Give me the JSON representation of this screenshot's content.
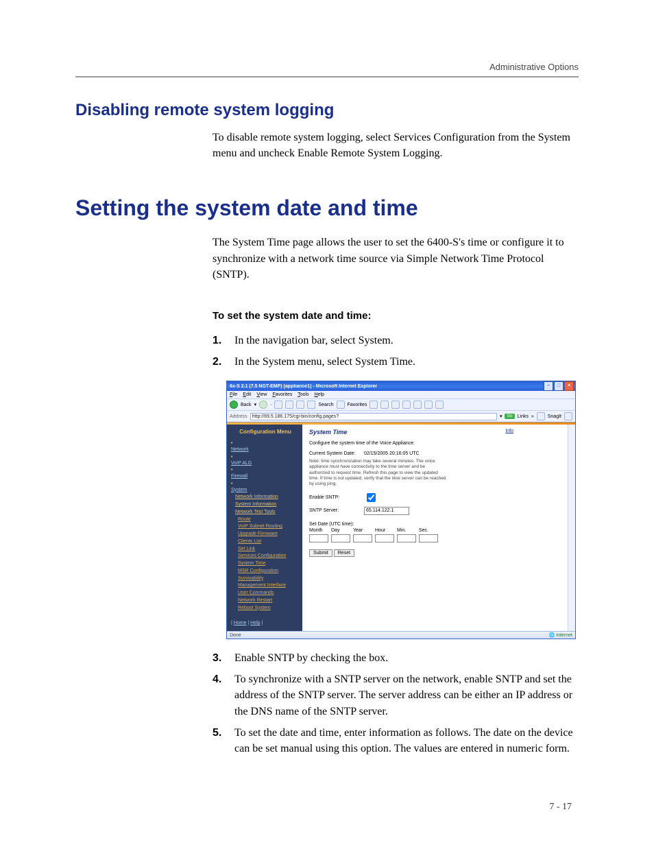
{
  "header": {
    "chapter": "Administrative Options"
  },
  "section1": {
    "title": "Disabling remote system logging",
    "body": "To disable remote system logging, select Services Configuration from the System menu and uncheck Enable Remote System Logging."
  },
  "section2": {
    "title": "Setting the system date and time",
    "intro": "The System Time page allows the user to set the 6400-S's time or configure it to synchronize with a network time source via Simple Network Time Protocol (SNTP).",
    "procTitle": "To set the system date and time:",
    "steps": [
      "In the navigation bar, select System.",
      "In the System menu, select System Time.",
      "Enable SNTP by checking the box.",
      "To synchronize with a SNTP server on the network, enable SNTP and set the address of the SNTP server. The server address can be either an IP address or the DNS name of the SNTP server.",
      "To set the date and time, enter information as follows. The date on the device can be set manual using this option. The values are entered in numeric form."
    ]
  },
  "pageNumber": "7 - 17",
  "screenshot": {
    "window": {
      "title": "6x-S 2.1 (7.5 NGT-EMP) [appliance1] - Microsoft Internet Explorer",
      "menubar": [
        "File",
        "Edit",
        "View",
        "Favorites",
        "Tools",
        "Help"
      ],
      "toolbar": {
        "back_label": "Back",
        "search_label": "Search",
        "favorites_label": "Favorites"
      },
      "address_label": "Address",
      "address_url": "http://69.5.186.175/cgi-bin/config.pages?",
      "go_label": "Go",
      "links_label": "Links",
      "snagit_label": "SnagIt",
      "status_done": "Done",
      "status_zone": "Internet"
    },
    "sidebar": {
      "title": "Configuration Menu",
      "top": [
        "Network",
        "VoIP ALG",
        "Firewall",
        "System"
      ],
      "systemSub": [
        "Network Information",
        "System Information",
        "Network Test Tools",
        "Route",
        "VoIP Subnet Routing",
        "Upgrade Firmware",
        "Clients List",
        "Set Link",
        "Services Configuration",
        "System Time",
        "MSR Configuration",
        "Survivability",
        "Management Interface",
        "User Commands",
        "Network Restart",
        "Reboot System"
      ],
      "bottom": {
        "home": "Home",
        "help": "Help"
      }
    },
    "panel": {
      "title": "System Time",
      "info": "Info",
      "desc": "Configure the system time of the Voice Appliance.",
      "currentLabel": "Current System Date:",
      "currentValue": "02/15/2005 20:16:05 UTC",
      "note": "Note: time synchronization may take several minutes. The voice appliance must have connectivity to the time server and be authorized to request time. Refresh this page to view the updated time. If time is not updated, verify that the time server can be reached by using ping.",
      "enableSntp": "Enable SNTP:",
      "sntpServer": "SNTP Server:",
      "sntpValue": "65.114.122.1",
      "setDate": "Set Date (UTC time):",
      "cols": {
        "month": "Month",
        "day": "Day",
        "year": "Year",
        "hour": "Hour",
        "min": "Min.",
        "sec": "Sec."
      },
      "submit": "Submit",
      "reset": "Reset"
    }
  }
}
